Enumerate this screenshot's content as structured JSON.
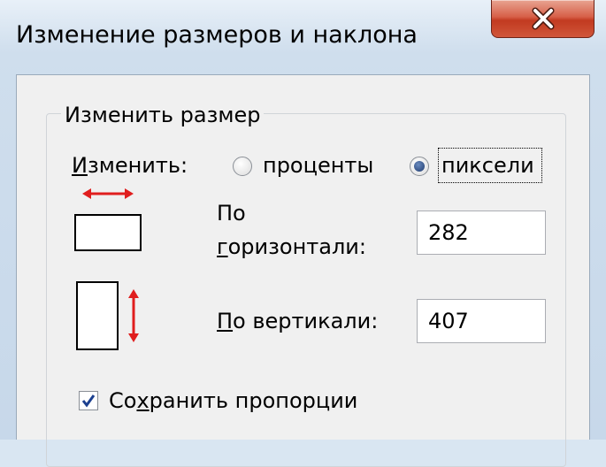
{
  "window": {
    "title": "Изменение размеров и наклона"
  },
  "resize_group": {
    "legend": "Изменить размер",
    "by_label_pre": "",
    "by_label_u": "И",
    "by_label_post": "зменить:",
    "options": [
      {
        "label": "проценты",
        "selected": false
      },
      {
        "label": "пиксели",
        "selected": true
      }
    ],
    "horizontal": {
      "label_line1": "По",
      "label_line2_pre": "",
      "label_line2_u": "г",
      "label_line2_post": "оризонтали:",
      "value": "282"
    },
    "vertical": {
      "label_u": "П",
      "label_post": "о вертикали:",
      "value": "407"
    },
    "keep_ratio": {
      "label_pre": "Со",
      "label_u": "х",
      "label_post": "ранить пропорции",
      "checked": true
    }
  },
  "colors": {
    "arrow": "#e01e1e",
    "close_button": "#c94a33",
    "check": "#1b3f8f"
  }
}
